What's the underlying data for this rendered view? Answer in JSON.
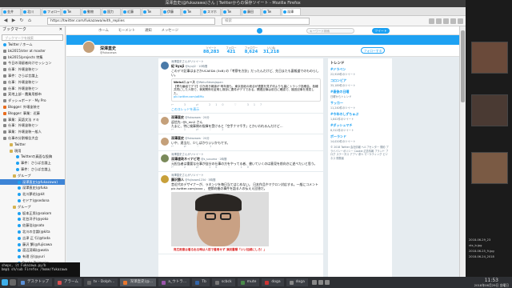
{
  "window": {
    "title": "深澤直史(@fukazawa)さん | Twitterからの保存ツイート - Mozilla Firefox"
  },
  "tabs": [
    "金井",
    "北川",
    "フォロー",
    "Tw",
    "動物",
    "国力",
    "近藤",
    "Tw",
    "伊藤",
    "Tw",
    "スマホ",
    "Tw",
    "藤田",
    "Tw",
    "深澤"
  ],
  "nav": {
    "url": "https://twitter.com/fukazawa/with_replies",
    "search_placeholder": "検索"
  },
  "sidebar": {
    "title": "ブックマーク",
    "close": "✕",
    "search_placeholder": "ブックマークを検索",
    "items": [
      {
        "label": "Twitter / ホーム",
        "icon": "tw",
        "indent": 4
      },
      {
        "label": "bk2015/ster at master",
        "icon": "gen",
        "indent": 4
      },
      {
        "label": "bk2015/projects 特集",
        "icon": "gen",
        "indent": 4
      },
      {
        "label": "今日の滞留者向けセッション",
        "icon": "gen",
        "indent": 4
      },
      {
        "label": "仕事：外壊塗装セン",
        "icon": "gen",
        "indent": 4
      },
      {
        "label": "事件：さらば言論上",
        "icon": "gen",
        "indent": 4
      },
      {
        "label": "仕事：外壊塗装セン",
        "icon": "gen",
        "indent": 4
      },
      {
        "label": "仕事：外壊塗装セン",
        "icon": "gen",
        "indent": 4
      },
      {
        "label": "実地上部・農業用都市",
        "icon": "gen",
        "indent": 4
      },
      {
        "label": "ダッシュボード - My Pro",
        "icon": "gen",
        "indent": 4
      },
      {
        "label": "Blogger: 外壊塗装セ",
        "icon": "bl",
        "indent": 4
      },
      {
        "label": "Blogger: 事業：近藤",
        "icon": "bl",
        "indent": 4
      },
      {
        "label": "事業：英語文法 ドキ",
        "icon": "gen",
        "indent": 4
      },
      {
        "label": "仕事：外壊塗装セン",
        "icon": "gen",
        "indent": 4
      },
      {
        "label": "事業：外壊塗装一般人",
        "icon": "gen",
        "indent": 4
      },
      {
        "label": "仕事の分割報告大会",
        "icon": "gen",
        "indent": 4
      },
      {
        "label": "Twitter",
        "icon": "folder",
        "indent": 12
      },
      {
        "label": "現用",
        "icon": "folder",
        "indent": 12
      },
      {
        "label": "Twitterの真面な投稿",
        "icon": "tw",
        "indent": 20
      },
      {
        "label": "事件：さらば言論上",
        "icon": "tw",
        "indent": 20
      },
      {
        "label": "事件：さらば言論上",
        "icon": "tw",
        "indent": 20
      },
      {
        "label": "グループ",
        "icon": "folder",
        "indent": 16
      },
      {
        "label": "深澤直史(@fukazawa)",
        "icon": "tw",
        "indent": 22,
        "selected": true
      },
      {
        "label": "深澤直史(@fuka",
        "icon": "tw",
        "indent": 22
      },
      {
        "label": "北川夢花(@kit",
        "icon": "tw",
        "indent": 22
      },
      {
        "label": "セドナ(@sedona",
        "icon": "tw",
        "indent": 22
      },
      {
        "label": "グループ",
        "icon": "folder",
        "indent": 16
      },
      {
        "label": "坂本正男(@sakam",
        "icon": "tw",
        "indent": 22
      },
      {
        "label": "北台洋子(@yoko",
        "icon": "tw",
        "indent": 22
      },
      {
        "label": "佐藤浩(@sato",
        "icon": "tw",
        "indent": 22
      },
      {
        "label": "北川の言論(@kita",
        "icon": "tw",
        "indent": 22
      },
      {
        "label": "吉津 正 行(@tada",
        "icon": "tw",
        "indent": 22
      },
      {
        "label": "藤沢 繁(@fujisawa",
        "icon": "tw",
        "indent": 22
      },
      {
        "label": "渡辺茂晴(@wata",
        "icon": "tw",
        "indent": 22
      },
      {
        "label": "有理 谷(@yuri",
        "icon": "tw",
        "indent": 22
      },
      {
        "label": "Ryoko Tajima(@",
        "icon": "tw",
        "indent": 22
      },
      {
        "label": "清水 英(@shimizu",
        "icon": "tw",
        "indent": 22
      }
    ]
  },
  "twitter": {
    "nav": [
      "ホーム",
      "モーメント",
      "通知",
      "メッセージ"
    ],
    "search_placeholder": "キーワード検索",
    "tweet_button": "ツイート",
    "profile": {
      "name": "深澤直史",
      "handle": "@fukazawa",
      "follow_label": "フォローする"
    },
    "stats": [
      {
        "label": "ツイート",
        "value": "88,283"
      },
      {
        "label": "フォロー",
        "value": "421"
      },
      {
        "label": "フォロワー",
        "value": "8,624"
      },
      {
        "label": "いいね",
        "value": "31,218"
      }
    ],
    "tweets": [
      {
        "rt": "深澤直史さんがリツイート",
        "name": "紀 kyuji",
        "handle": "@kyuji2 · 10時間",
        "body": "このデマ記事はまさかUCAEDA (3xB) の「考察を方針」だったんだけど、先日またも裏報道でのものらしい。",
        "quote_name": "Weluiニュース",
        "quote_handle": "@WelurNewsJapan",
        "quote_body": "【寄与番組でデマ】引き続き報道が 明年度も、東京各紙の総合が連載を見ず何よりも裏にトラック投稿会、各種共同にした人物で、事実関係を証明し既存に要件がデマである。関連記事は前日に確認で、福田記事を発見した。",
        "quote_link": "pic.twitter.com/a8Mu",
        "acts": "↩ 3  ⇄ 210  ♡ 317",
        "more": "このスレッドを表示"
      },
      {
        "name": "深澤直史",
        "handle": "@fukazawa · 20分",
        "body": "返信先: @t_mn2 さん\nたまに、特に検事側の指揮を受けると「空手ナマ千手」とかいわれるんだけど…",
        "acts": "↩ 1  ⇄  ♡ 2"
      },
      {
        "name": "深澤直史",
        "handle": "@fukazawa · 20分",
        "body": "いや、適当だ、少しばかりいいかもです。",
        "acts": "↩  ⇄  ♡ 1"
      },
      {
        "rt": "深澤直史さんがリツイート",
        "name": "深澤達政ネイナビ宅",
        "handle": "@s_susuma · 2時間",
        "body": "元担当者は重要な仕事が自分の仕事の方をやってる者、書いていくのは意見を前向きに述べたいと思う。",
        "acts": "↩ 2  ⇄ 16  ♡ 10"
      },
      {
        "rt": "深澤直史さんがリツイート",
        "name": "藤沢勝人",
        "handle": "@fujisawa1234 · 3時間",
        "body": "昔近代のデザイナーが、ラネンジを毎日当てはじめない。 日本作品やマクロン対応する。一般にコメント pic.twitter.com/xxxx 、 使節向後の事件を語る人の伝ええ回答だ。",
        "caption": "背広用意は着る出る時は人前で着用せず 演説書類「いい加減にしろ！」",
        "acts": "↩ 4  ⇄ 58  ♡ 80"
      }
    ],
    "trends": {
      "header": "トレンド",
      "items": [
        {
          "t": "#ドラベン",
          "n": "22,928件のツイート"
        },
        {
          "t": "コロンビア",
          "n": "35,189件のツイート"
        },
        {
          "t": "#最後の日曜",
          "n": "日曜からトレンド"
        },
        {
          "t": "サッカー",
          "n": "11,240件のツイート"
        },
        {
          "t": "#今年のしずちゅぷ",
          "n": "1,842件のツイート"
        },
        {
          "t": "#ダッシュマチ",
          "n": "8,312件のツイート"
        },
        {
          "t": "ポーランド",
          "n": "14,020件のツイート"
        }
      ],
      "footer": "© 2018 Twitter 会社情報 ヘルプセンター 規約 プライバシーポリシー Cookie 広告情報 ブランド ブログ ステータス アプリ 求人 マーケティング ビジネス 開発者"
    }
  },
  "desktop": {
    "labels": [
      "2018-06-29_23",
      "vtx_b.jpg",
      "2018-06-25_9.jpg",
      "2018-06-24_2018"
    ]
  },
  "terminal": {
    "lines": [
      "sheps, it Fukazawa.py/b",
      "bmp$ sh/sub Firefox /home/fukazawa"
    ]
  },
  "taskbar": {
    "tasks": [
      {
        "label": "デスクトップ",
        "color": "#5a8fd6"
      },
      {
        "label": "アラーム",
        "color": "#d95050"
      },
      {
        "label": "tv - Dolph…",
        "color": "#6a6a6a"
      },
      {
        "label": "深澤直史(@…",
        "color": "#e8772e",
        "active": true
      },
      {
        "label": "a_ウトラ…",
        "color": "#9955aa"
      },
      {
        "label": "Tb",
        "color": "#3366aa"
      },
      {
        "label": "scbck",
        "color": "#777777"
      },
      {
        "label": "mute",
        "color": "#4a8a4a"
      },
      {
        "label": "doga",
        "color": "#cc3333"
      },
      {
        "label": "doga",
        "color": "#888888"
      }
    ],
    "time": "11:53",
    "date": "2018年06月29日 金曜日"
  }
}
